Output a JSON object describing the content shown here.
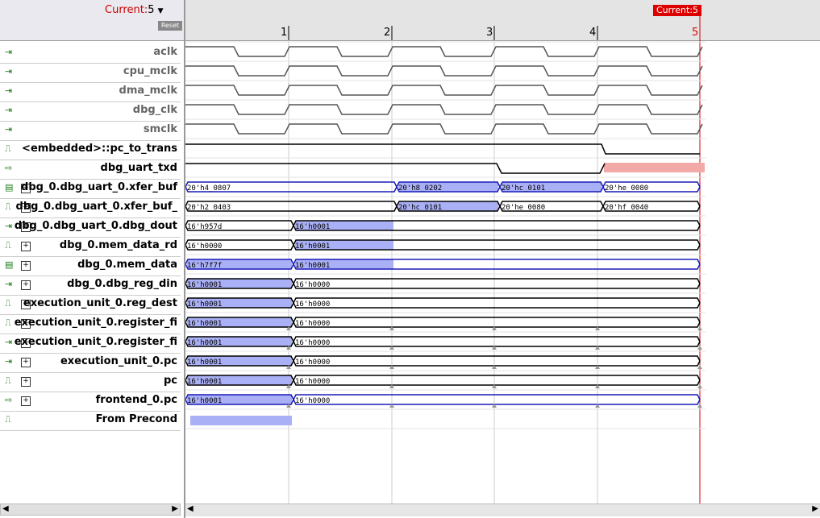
{
  "header": {
    "current_label": "Current:",
    "current_value": "5",
    "dropdown_icon": "caret-down-icon",
    "reset_label": "Reset"
  },
  "timeline": {
    "cursor_label": "Current:5",
    "ticks": [
      "1",
      "2",
      "3",
      "4",
      "5"
    ],
    "scroll_ticks": [
      "1 |",
      "2 |",
      "3 |",
      "4 |",
      "5"
    ]
  },
  "signals": [
    {
      "name": "aclk",
      "icon": "input-icon",
      "expand": false,
      "grey": true
    },
    {
      "name": "cpu_mclk",
      "icon": "input-icon",
      "expand": false,
      "grey": true
    },
    {
      "name": "dma_mclk",
      "icon": "input-icon",
      "expand": false,
      "grey": true
    },
    {
      "name": "dbg_clk",
      "icon": "input-icon",
      "expand": false,
      "grey": true
    },
    {
      "name": "smclk",
      "icon": "input-icon",
      "expand": false,
      "grey": true
    },
    {
      "name": "<embedded>::pc_to_trans",
      "icon": "pulse-icon",
      "expand": false,
      "grey": false
    },
    {
      "name": "dbg_uart_txd",
      "icon": "output-icon",
      "expand": false,
      "grey": false
    },
    {
      "name": "dbg_0.dbg_uart_0.xfer_buf",
      "icon": "register-icon",
      "expand": true,
      "grey": false
    },
    {
      "name": "dbg_0.dbg_uart_0.xfer_buf_",
      "icon": "pulse-icon",
      "expand": true,
      "grey": false
    },
    {
      "name": "dbg_0.dbg_uart_0.dbg_dout",
      "icon": "input-icon",
      "expand": true,
      "grey": false
    },
    {
      "name": "dbg_0.mem_data_rd",
      "icon": "pulse-icon",
      "expand": true,
      "grey": false
    },
    {
      "name": "dbg_0.mem_data",
      "icon": "register-icon",
      "expand": true,
      "grey": false
    },
    {
      "name": "dbg_0.dbg_reg_din",
      "icon": "input-icon",
      "expand": true,
      "grey": false
    },
    {
      "name": "execution_unit_0.reg_dest",
      "icon": "pulse-icon",
      "expand": true,
      "grey": false
    },
    {
      "name": "execution_unit_0.register_fi",
      "icon": "pulse-icon",
      "expand": true,
      "grey": false
    },
    {
      "name": "execution_unit_0.register_fi",
      "icon": "input-icon",
      "expand": true,
      "grey": false
    },
    {
      "name": "execution_unit_0.pc",
      "icon": "input-icon",
      "expand": true,
      "grey": false
    },
    {
      "name": "pc",
      "icon": "pulse-icon",
      "expand": true,
      "grey": false
    },
    {
      "name": "frontend_0.pc",
      "icon": "output-icon",
      "expand": true,
      "grey": false
    },
    {
      "name": "From Precond",
      "icon": "pulse-icon",
      "expand": false,
      "grey": false
    }
  ],
  "bus_values": [
    [
      "20'h4_0807",
      "20'h8_0202",
      "20'hc_0101",
      "20'he_0080"
    ],
    [
      "20'h2_0403",
      "20'hc_0101",
      "20'he_0080",
      "20'hf_0040"
    ],
    [
      "16'h957d",
      "16'h0001"
    ],
    [
      "16'h0000",
      "16'h0001"
    ],
    [
      "16'h7f7f",
      "16'h0001"
    ],
    [
      "16'h0001",
      "16'h0000"
    ],
    [
      "16'h0001",
      "16'h0000"
    ],
    [
      "16'h0001",
      "16'h0000"
    ],
    [
      "16'h0001",
      "16'h0000"
    ],
    [
      "16'h0001",
      "16'h0000"
    ],
    [
      "16'h0001",
      "16'h0000"
    ],
    [
      "16'h0001",
      "16'h0000"
    ]
  ],
  "colors": {
    "highlight": "#aab0f5",
    "bus_blue": "#1a1ab8",
    "cursor": "#d00000",
    "txd_fill": "#f4a9a9"
  }
}
